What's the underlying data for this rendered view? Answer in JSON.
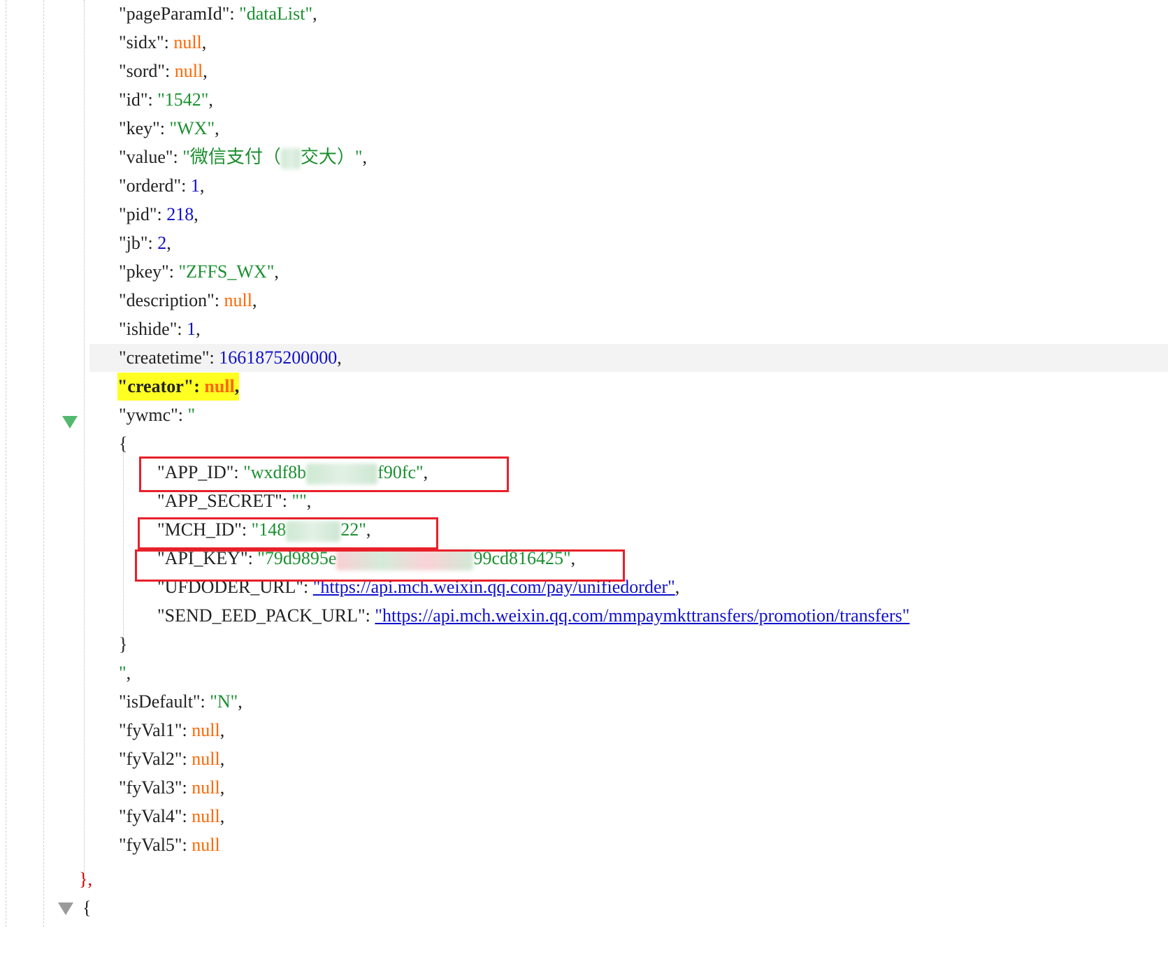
{
  "lines": {
    "pageParamId": {
      "key": "\"pageParamId\"",
      "value": "\"dataList\""
    },
    "sidx": {
      "key": "\"sidx\"",
      "value": "null"
    },
    "sord": {
      "key": "\"sord\"",
      "value": "null"
    },
    "id": {
      "key": "\"id\"",
      "value": "\"1542\""
    },
    "key": {
      "key": "\"key\"",
      "value": "\"WX\""
    },
    "value": {
      "key": "\"value\"",
      "value_start": "\"微信支付（",
      "value_end": "交大）\""
    },
    "orderd": {
      "key": "\"orderd\"",
      "value": "1"
    },
    "pid": {
      "key": "\"pid\"",
      "value": "218"
    },
    "jb": {
      "key": "\"jb\"",
      "value": "2"
    },
    "pkey": {
      "key": "\"pkey\"",
      "value": "\"ZFFS_WX\""
    },
    "description": {
      "key": "\"description\"",
      "value": "null"
    },
    "ishide": {
      "key": "\"ishide\"",
      "value": "1"
    },
    "createtime": {
      "key": "\"createtime\"",
      "value": "1661875200000"
    },
    "creator": {
      "key": "\"creator\"",
      "value": "null"
    },
    "ywmc": {
      "key": "\"ywmc\"",
      "value_open": "\""
    },
    "ywmc_open_brace": "{",
    "app_id": {
      "key": "\"APP_ID\"",
      "value_start": "\"wxdf8b",
      "value_end": "f90fc\""
    },
    "app_secret": {
      "key": "\"APP_SECRET\"",
      "value": "\"\""
    },
    "mch_id": {
      "key": "\"MCH_ID\"",
      "value_start": "\"148",
      "value_end": "22\""
    },
    "api_key": {
      "key": "\"API_KEY\"",
      "value_start": "\"79d9895e",
      "value_end": "99cd816425\""
    },
    "ufdoder_url": {
      "key": "\"UFDODER_URL\"",
      "value": "\"https://api.mch.weixin.qq.com/pay/unifiedorder\""
    },
    "send_eed_pack_url": {
      "key": "\"SEND_EED_PACK_URL\"",
      "value": "\"https://api.mch.weixin.qq.com/mmpaymkttransfers/promotion/transfers\""
    },
    "ywmc_close_brace": "}",
    "ywmc_close_quote": "\"",
    "isDefault": {
      "key": "\"isDefault\"",
      "value": "\"N\""
    },
    "fyVal1": {
      "key": "\"fyVal1\"",
      "value": "null"
    },
    "fyVal2": {
      "key": "\"fyVal2\"",
      "value": "null"
    },
    "fyVal3": {
      "key": "\"fyVal3\"",
      "value": "null"
    },
    "fyVal4": {
      "key": "\"fyVal4\"",
      "value": "null"
    },
    "fyVal5": {
      "key": "\"fyVal5\"",
      "value": "null"
    },
    "object_close": "}",
    "next_object_open": "{"
  },
  "punct": {
    "colon": ": ",
    "comma": ","
  },
  "icons": {
    "fold_ywmc": "fold-arrow-icon",
    "fold_next": "fold-arrow-icon"
  },
  "colors": {
    "string": "#1a8f2f",
    "number": "#1111cc",
    "null": "#ff6600",
    "highlight": "#ffff22",
    "annotation_box": "#e8202a",
    "fold_arrow_active": "#52b96e",
    "fold_arrow_inactive": "#9a9a9a"
  }
}
